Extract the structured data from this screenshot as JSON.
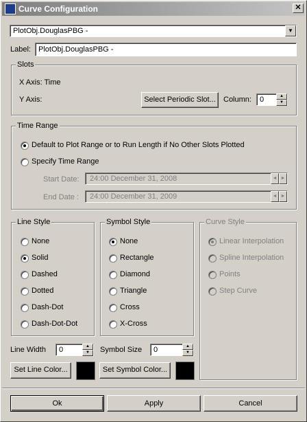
{
  "window": {
    "title": "Curve Configuration",
    "close_glyph": "✕"
  },
  "object": {
    "selected": "PlotObj.DouglasPBG -",
    "arrow": "▼"
  },
  "label": {
    "caption": "Label:",
    "value": "PlotObj.DouglasPBG -"
  },
  "slots": {
    "legend": "Slots",
    "x_axis": "X Axis:  Time",
    "y_axis": "Y Axis:",
    "select_button": "Select Periodic Slot...",
    "column_label": "Column:",
    "column_value": "0"
  },
  "time_range": {
    "legend": "Time Range",
    "default_option": "Default to Plot Range or to Run Length if No Other Slots Plotted",
    "specify_option": "Specify Time Range",
    "start_label": "Start Date:",
    "start_value": "24:00 December 31, 2008",
    "end_label": "End Date :",
    "end_value": "24:00 December 31, 2009"
  },
  "line_style": {
    "legend": "Line Style",
    "options": [
      "None",
      "Solid",
      "Dashed",
      "Dotted",
      "Dash-Dot",
      "Dash-Dot-Dot"
    ],
    "selected": "Solid"
  },
  "symbol_style": {
    "legend": "Symbol Style",
    "options": [
      "None",
      "Rectangle",
      "Diamond",
      "Triangle",
      "Cross",
      "X-Cross"
    ],
    "selected": "None"
  },
  "curve_style": {
    "legend": "Curve Style",
    "options": [
      "Linear Interpolation",
      "Spline Interpolation",
      "Points",
      "Step Curve"
    ],
    "selected": "Linear Interpolation"
  },
  "line_width": {
    "label": "Line Width",
    "value": "0"
  },
  "symbol_size": {
    "label": "Symbol Size",
    "value": "0"
  },
  "buttons": {
    "set_line_color": "Set Line Color...",
    "set_symbol_color": "Set Symbol Color...",
    "ok": "Ok",
    "apply": "Apply",
    "cancel": "Cancel"
  },
  "colors": {
    "line_color": "#000000",
    "symbol_color": "#000000"
  }
}
